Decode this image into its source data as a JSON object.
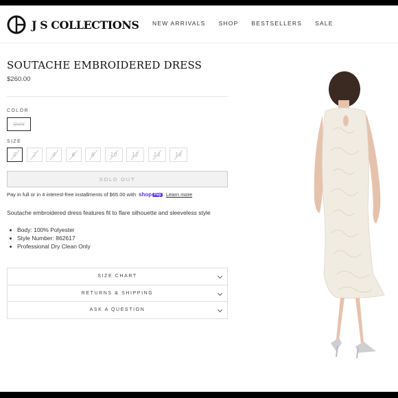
{
  "brand": {
    "name": "J S COLLECTIONS",
    "logo_icon": "js-circle-logo-icon"
  },
  "nav": {
    "items": [
      "NEW ARRIVALS",
      "SHOP",
      "BESTSELLERS",
      "SALE"
    ]
  },
  "product": {
    "title": "SOUTACHE EMBROIDERED DRESS",
    "price": "$260.00",
    "color_label": "COLOR",
    "color_value": "Gold",
    "size_label": "SIZE",
    "sizes": [
      "0",
      "2",
      "4",
      "6",
      "8",
      "10",
      "12",
      "14",
      "16"
    ],
    "selected_size": "0",
    "soldout_label": "SOLD OUT",
    "installments_text": "Pay in full or in 4 interest-free installments of $65.00 with",
    "shop_pay_label": "shop",
    "shop_pay_badge": "Pay",
    "learn_more": "Learn more",
    "description": "Soutache embroidered dress features fit to flare silhouette and sleeveless style",
    "details": [
      "Body: 100% Polyester",
      "Style Number: 862617",
      "Professional Dry Clean Only"
    ]
  },
  "accordion": {
    "items": [
      "SIZE CHART",
      "RETURNS & SHIPPING",
      "ASK A QUESTION"
    ]
  },
  "colors": {
    "accent": "#5a31f4",
    "bar": "#000000"
  }
}
